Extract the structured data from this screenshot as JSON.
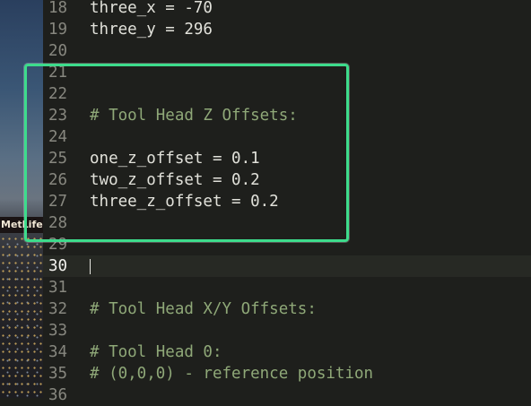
{
  "lines": [
    {
      "n": "18",
      "text": "three_x = -70",
      "kind": "plain"
    },
    {
      "n": "19",
      "text": "three_y = 296",
      "kind": "plain"
    },
    {
      "n": "20",
      "text": "",
      "kind": "plain"
    },
    {
      "n": "21",
      "text": "",
      "kind": "plain"
    },
    {
      "n": "22",
      "text": "",
      "kind": "plain"
    },
    {
      "n": "23",
      "text": "# Tool Head Z Offsets:",
      "kind": "comment"
    },
    {
      "n": "24",
      "text": "",
      "kind": "plain"
    },
    {
      "n": "25",
      "text": "one_z_offset = 0.1",
      "kind": "plain"
    },
    {
      "n": "26",
      "text": "two_z_offset = 0.2",
      "kind": "plain"
    },
    {
      "n": "27",
      "text": "three_z_offset = 0.2",
      "kind": "plain"
    },
    {
      "n": "28",
      "text": "",
      "kind": "plain"
    },
    {
      "n": "29",
      "text": "",
      "kind": "plain"
    },
    {
      "n": "30",
      "text": "",
      "kind": "plain",
      "active": true
    },
    {
      "n": "31",
      "text": "",
      "kind": "plain"
    },
    {
      "n": "32",
      "text": "# Tool Head X/Y Offsets:",
      "kind": "comment"
    },
    {
      "n": "33",
      "text": "",
      "kind": "plain"
    },
    {
      "n": "34",
      "text": "# Tool Head 0:",
      "kind": "comment"
    },
    {
      "n": "35",
      "text": "# (0,0,0) - reference position",
      "kind": "comment"
    },
    {
      "n": "36",
      "text": "",
      "kind": "plain"
    }
  ],
  "background_sign_text": "MetLife",
  "colors": {
    "highlight_border": "#3ddc8c",
    "comment": "#8fa878",
    "code": "#e1e1da",
    "line_number": "#87877f",
    "editor_bg": "#1e1f1c"
  }
}
